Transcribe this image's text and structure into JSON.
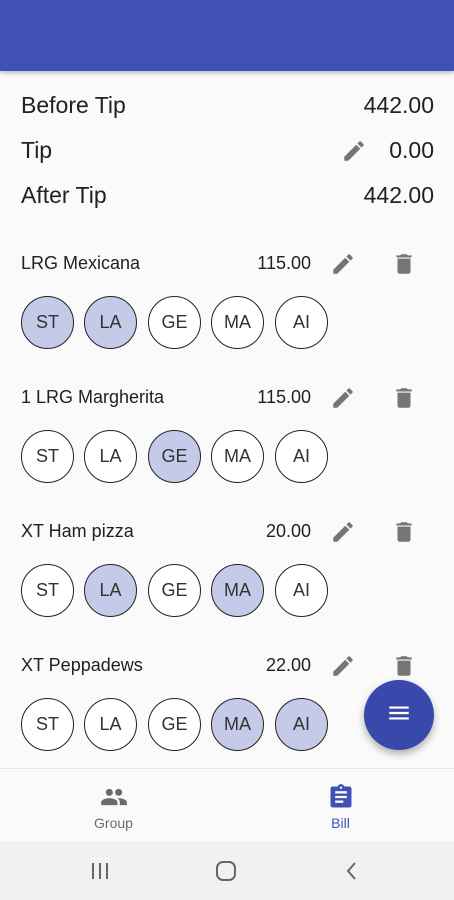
{
  "totals": {
    "before_tip_label": "Before Tip",
    "before_tip_value": "442.00",
    "tip_label": "Tip",
    "tip_value": "0.00",
    "after_tip_label": "After Tip",
    "after_tip_value": "442.00"
  },
  "items": [
    {
      "name": "LRG Mexicana",
      "price": "115.00",
      "members": [
        "ST",
        "LA",
        "GE",
        "MA",
        "AI"
      ],
      "selected": [
        true,
        true,
        false,
        false,
        false
      ]
    },
    {
      "name": "1 LRG Margherita",
      "price": "115.00",
      "members": [
        "ST",
        "LA",
        "GE",
        "MA",
        "AI"
      ],
      "selected": [
        false,
        false,
        true,
        false,
        false
      ]
    },
    {
      "name": "XT Ham pizza",
      "price": "20.00",
      "members": [
        "ST",
        "LA",
        "GE",
        "MA",
        "AI"
      ],
      "selected": [
        false,
        true,
        false,
        true,
        false
      ]
    },
    {
      "name": "XT Peppadews",
      "price": "22.00",
      "members": [
        "ST",
        "LA",
        "GE",
        "MA",
        "AI"
      ],
      "selected": [
        false,
        false,
        false,
        true,
        true
      ]
    }
  ],
  "fab": {
    "icon": "menu-icon"
  },
  "bottom_nav": {
    "group_label": "Group",
    "group_icon": "people-icon",
    "bill_label": "Bill",
    "bill_icon": "clipboard-icon",
    "active": "Bill"
  },
  "colors": {
    "primary": "#3f51b5",
    "fab": "#3949ab",
    "chip_selected": "#c5cae9"
  }
}
